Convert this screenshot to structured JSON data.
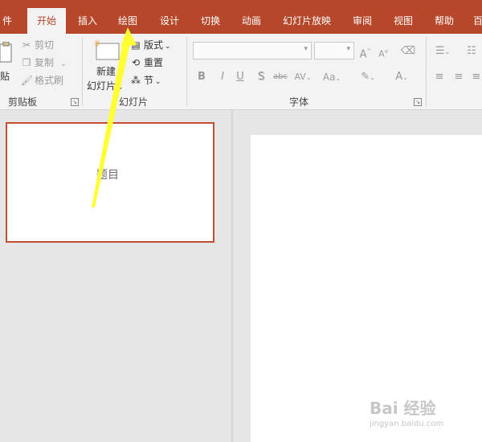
{
  "tabs": {
    "file": "件",
    "home": "开始",
    "insert": "插入",
    "draw": "绘图",
    "design": "设计",
    "transitions": "切换",
    "animations": "动画",
    "slideshow": "幻灯片放映",
    "review": "审阅",
    "view": "视图",
    "help": "帮助",
    "more": "百"
  },
  "clipboard": {
    "paste": "贴",
    "cut": "剪切",
    "copy": "复制",
    "format_painter": "格式刷",
    "group_label": "剪贴板"
  },
  "slides": {
    "new_slide_line1": "新建",
    "new_slide_line2": "幻灯片",
    "layout": "版式",
    "reset": "重置",
    "section": "节",
    "group_label": "幻灯片"
  },
  "font": {
    "group_label": "字体",
    "bold": "B",
    "italic": "I",
    "underline": "U",
    "shadow": "S",
    "strikethrough": "abc",
    "spacing": "AV",
    "case": "Aa",
    "grow": "A",
    "shrink": "A",
    "color": "A"
  },
  "thumbnail": {
    "title": "题目"
  },
  "watermark": {
    "brand": "Bai 经验",
    "url": "jingyan.baidu.com"
  },
  "colors": {
    "accent": "#b7472a",
    "arrow": "#ffff33"
  }
}
